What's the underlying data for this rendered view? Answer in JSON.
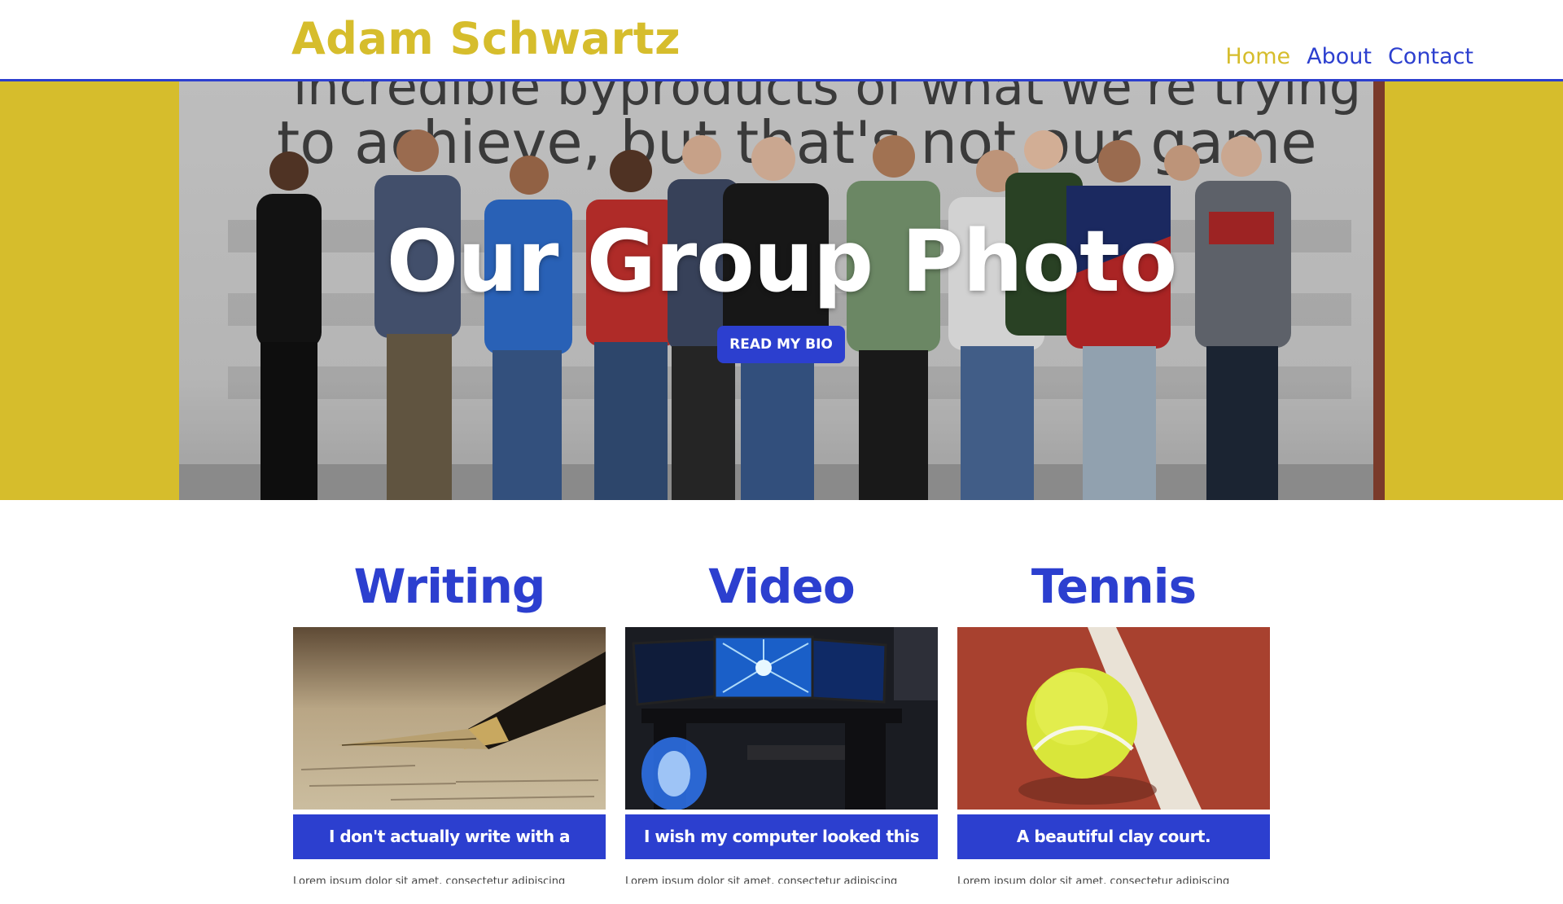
{
  "header": {
    "brand": "Adam Schwartz",
    "nav": [
      {
        "label": "Home",
        "active": true
      },
      {
        "label": "About",
        "active": false
      },
      {
        "label": "Contact",
        "active": false
      }
    ]
  },
  "hero": {
    "title": "Our Group Photo",
    "button_label": "READ MY BIO",
    "wall_text": [
      "incredible byproducts of what we're trying",
      "to achieve, but that's not our game"
    ]
  },
  "features": [
    {
      "title": "Writing",
      "caption": "I don't actually write with a fountain pen",
      "image": "fountain-pen-photo",
      "description": "Lorem ipsum dolor sit amet, consectetur adipiscing"
    },
    {
      "title": "Video Games",
      "caption": "I wish my computer looked this nice",
      "image": "gaming-computer-photo",
      "description": "Lorem ipsum dolor sit amet, consectetur adipiscing"
    },
    {
      "title": "Tennis",
      "caption": "A beautiful clay court.",
      "image": "tennis-ball-photo",
      "description": "Lorem ipsum dolor sit amet, consectetur adipiscing"
    }
  ],
  "colors": {
    "accent_yellow": "#d6bd2c",
    "accent_blue": "#2c3fcf",
    "background": "#ffffff"
  }
}
